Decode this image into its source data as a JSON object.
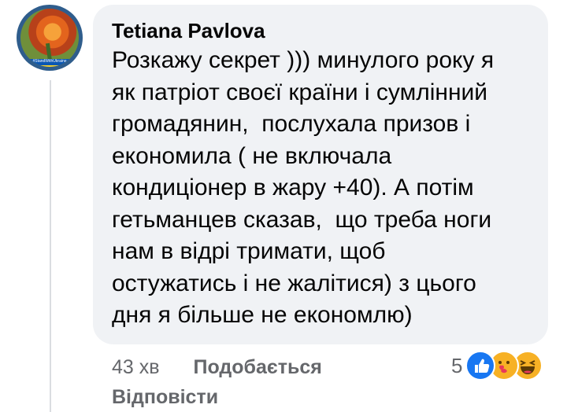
{
  "comment": {
    "author": "Tetiana Pavlova",
    "avatar_badge": "#StandWithUkraine",
    "text": "Розкажу секрет ))) минулого року я\nяк патріот своєї країни і сумлінний\nгромадянин,  послухала призов і\nекономила ( не включала\nкондиціонер в жару +40). А потім\nгетьманцев сказав,  що треба ноги\nнам в відрі тримати, щоб\nостужатись і не жалітися) з цього\nдня я більше не економлю)"
  },
  "meta": {
    "time": "43 хв",
    "like_label": "Подобається",
    "reply_label": "Відповісти"
  },
  "reactions": {
    "count": "5",
    "icons": [
      "like-icon",
      "care-icon",
      "haha-icon"
    ]
  }
}
